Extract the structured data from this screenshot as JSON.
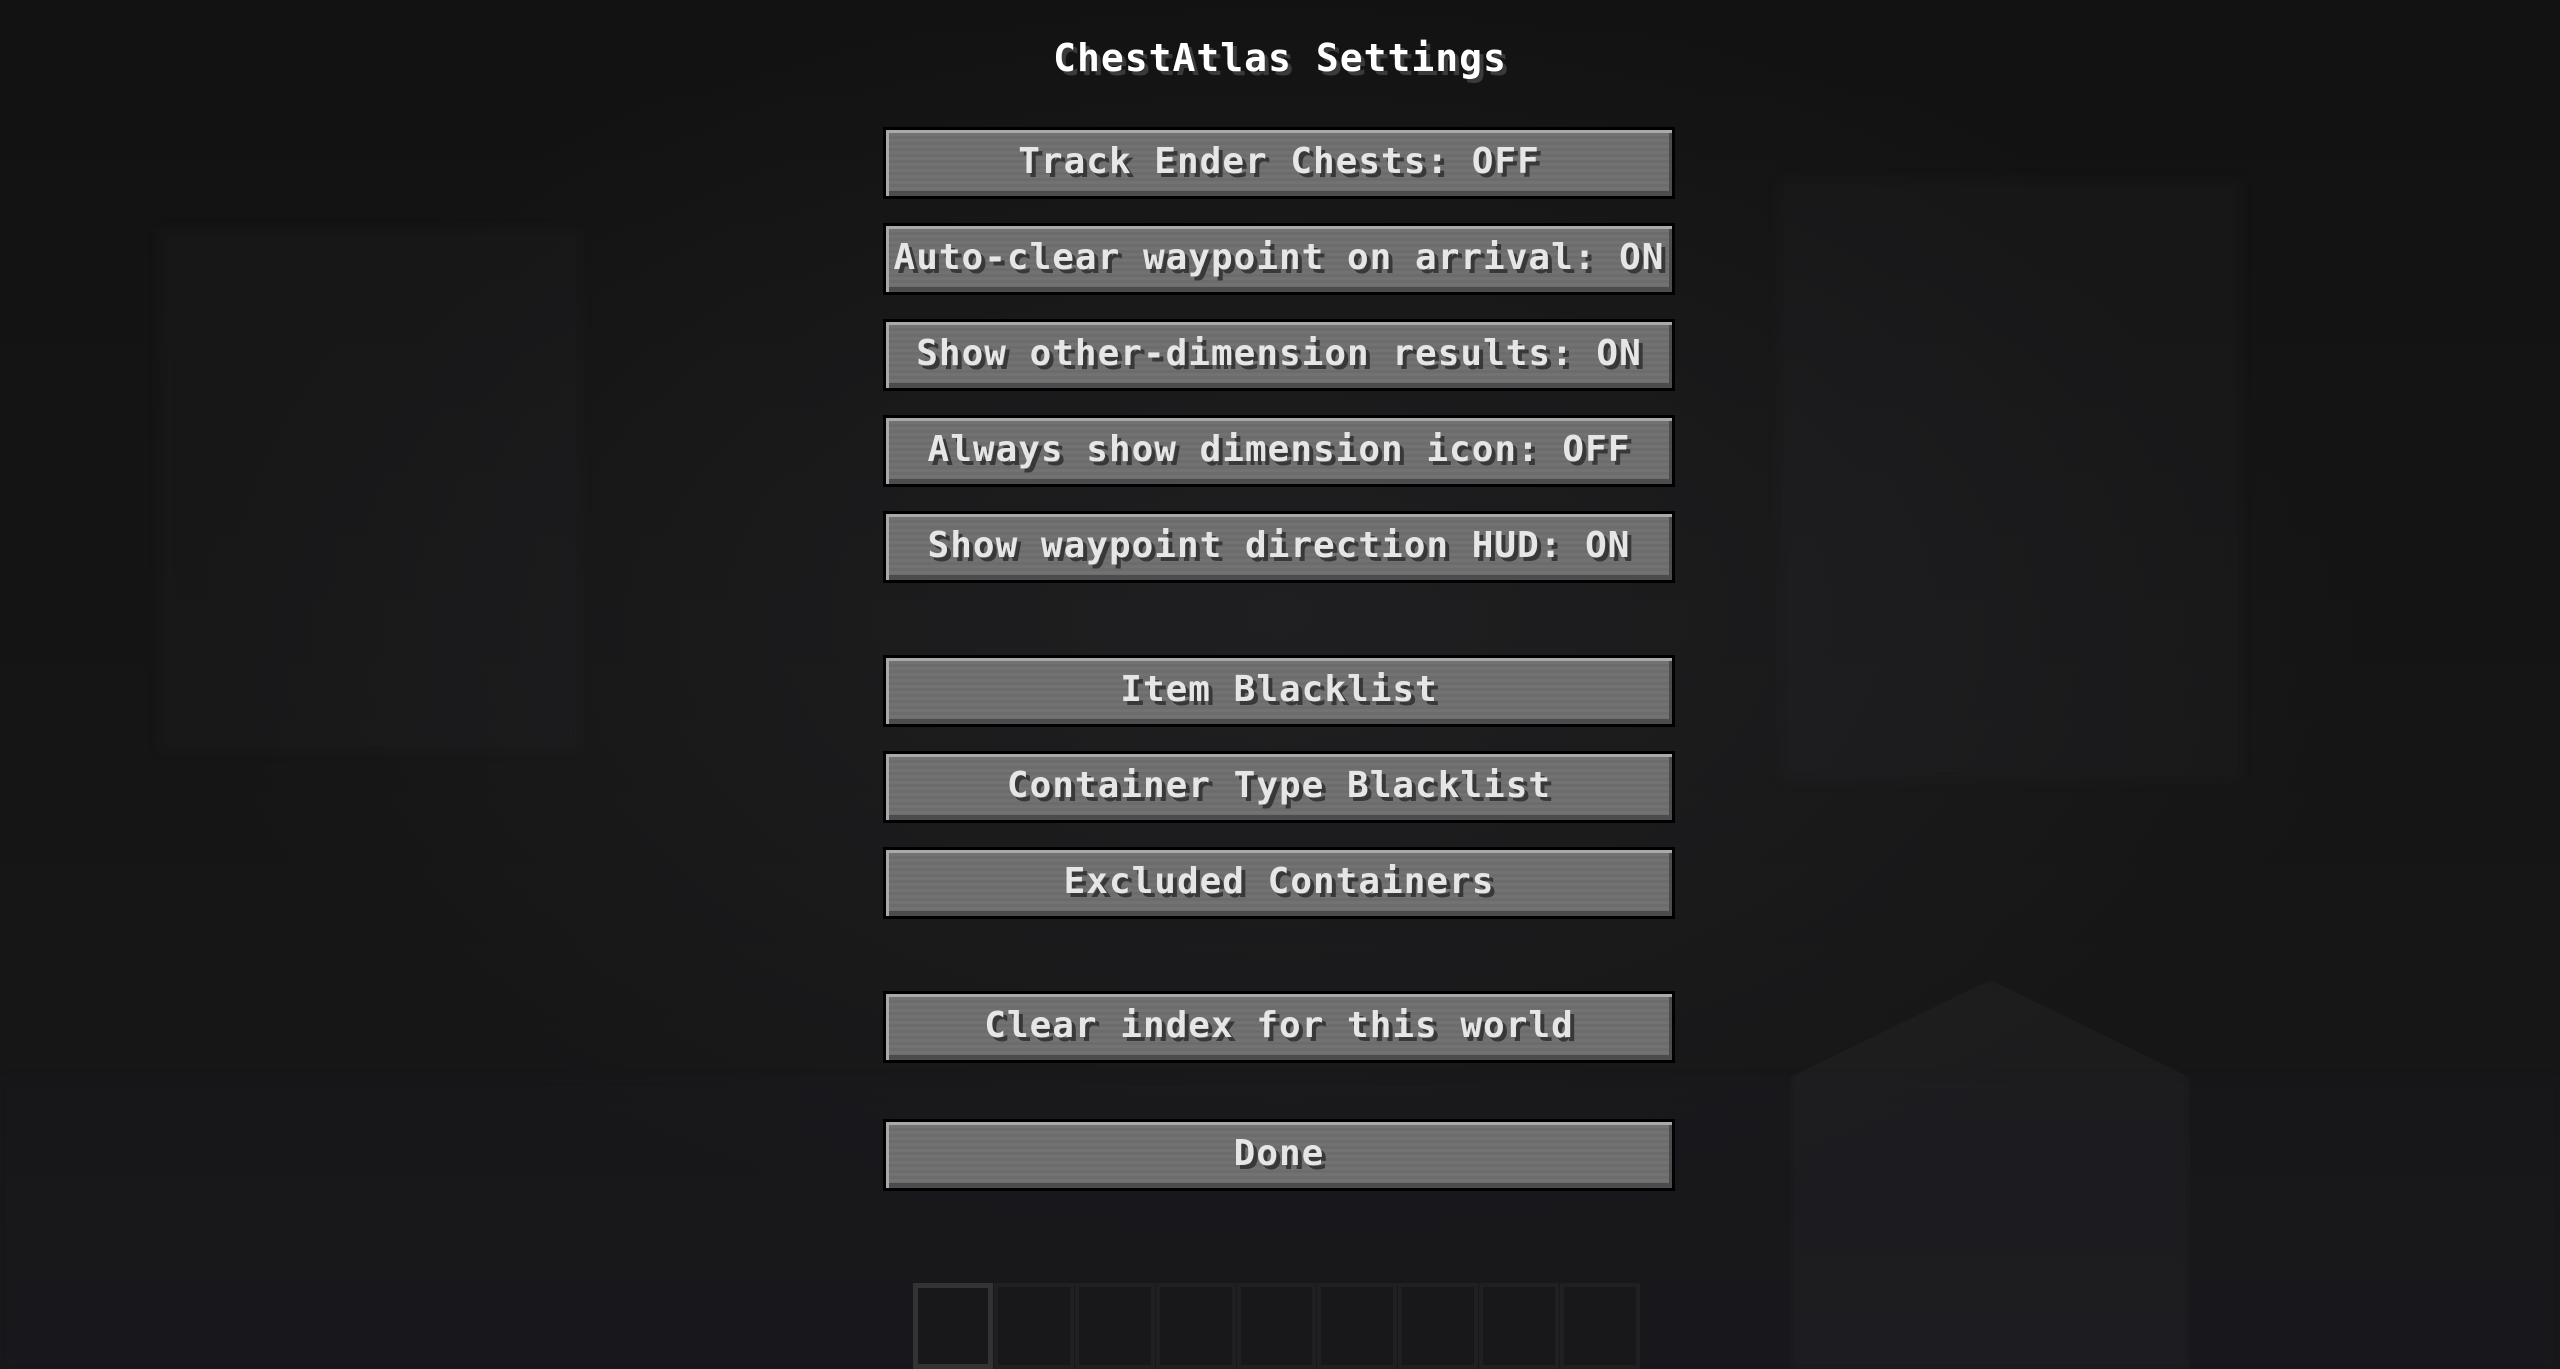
{
  "screen": {
    "title": "ChestAtlas Settings"
  },
  "toggles": [
    {
      "label": "Track Ender Chests: OFF"
    },
    {
      "label": "Auto-clear waypoint on arrival: ON"
    },
    {
      "label": "Show other-dimension results: ON"
    },
    {
      "label": "Always show dimension icon: OFF"
    },
    {
      "label": "Show waypoint direction HUD: ON"
    }
  ],
  "lists": [
    {
      "label": "Item Blacklist"
    },
    {
      "label": "Container Type Blacklist"
    },
    {
      "label": "Excluded Containers"
    }
  ],
  "actions": {
    "clear_label": "Clear index for this world",
    "done_label": "Done"
  },
  "hotbar": {
    "slot_count": 9,
    "selected_slot": 1
  }
}
